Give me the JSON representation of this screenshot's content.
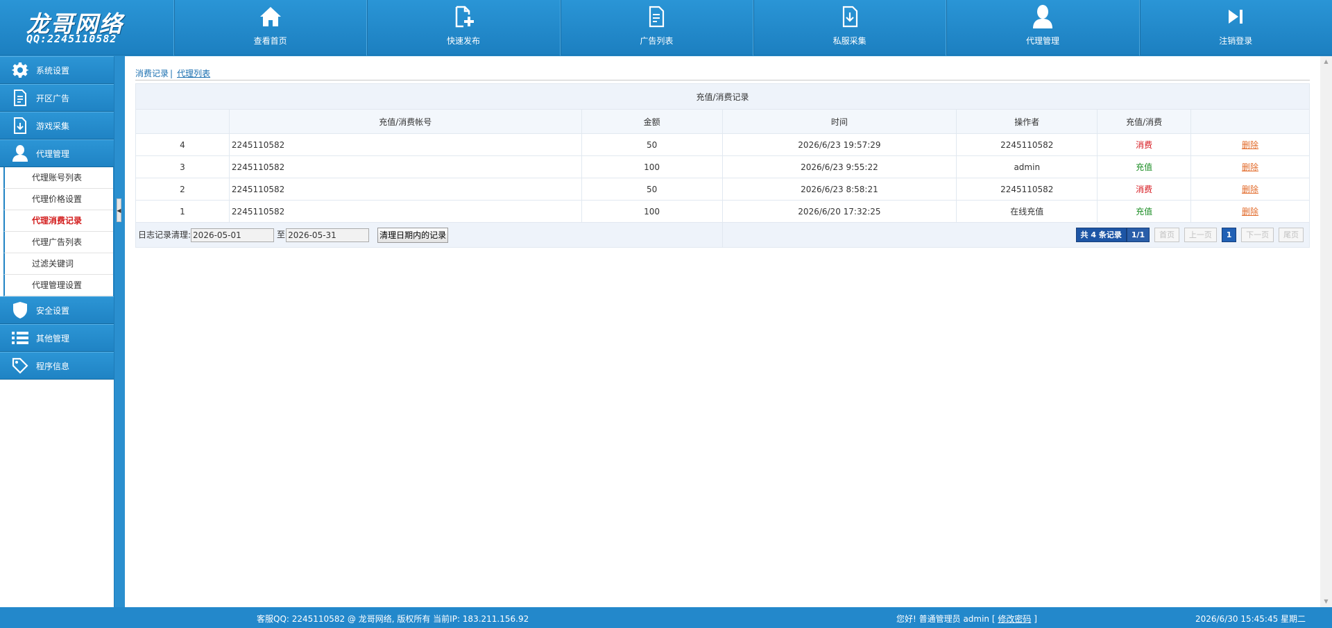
{
  "logo": {
    "brand": "龙哥网络",
    "qq": "QQ:2245110582"
  },
  "nav": [
    {
      "label": "查看首页",
      "icon": "home-icon"
    },
    {
      "label": "快速发布",
      "icon": "file-add-icon"
    },
    {
      "label": "广告列表",
      "icon": "document-list-icon"
    },
    {
      "label": "私服采集",
      "icon": "download-file-icon"
    },
    {
      "label": "代理管理",
      "icon": "user-icon"
    },
    {
      "label": "注销登录",
      "icon": "logout-icon"
    }
  ],
  "sidebar": {
    "top_groups": [
      {
        "label": "系统设置",
        "icon": "gear-icon"
      },
      {
        "label": "开区广告",
        "icon": "document-icon"
      },
      {
        "label": "游戏采集",
        "icon": "download-icon"
      },
      {
        "label": "代理管理",
        "icon": "user-icon"
      }
    ],
    "sub_items": [
      "代理账号列表",
      "代理价格设置",
      "代理消费记录",
      "代理广告列表",
      "过滤关键词",
      "代理管理设置"
    ],
    "active_sub": "代理消费记录",
    "bottom_groups": [
      {
        "label": "安全设置",
        "icon": "shield-icon"
      },
      {
        "label": "其他管理",
        "icon": "list-icon"
      },
      {
        "label": "程序信息",
        "icon": "tag-icon"
      }
    ]
  },
  "tabs": {
    "current": "消费记录",
    "separator": "|",
    "other": "代理列表"
  },
  "table": {
    "caption": "充值/消费记录",
    "headers": [
      "",
      "充值/消费帐号",
      "金额",
      "时间",
      "操作者",
      "充值/消费",
      ""
    ],
    "rows": [
      {
        "id": "4",
        "account": "2245110582",
        "amount": "50",
        "time": "2026/6/23 19:57:29",
        "operator": "2245110582",
        "type": "消费",
        "action": "删除"
      },
      {
        "id": "3",
        "account": "2245110582",
        "amount": "100",
        "time": "2026/6/23 9:55:22",
        "operator": "admin",
        "type": "充值",
        "action": "删除"
      },
      {
        "id": "2",
        "account": "2245110582",
        "amount": "50",
        "time": "2026/6/23 8:58:21",
        "operator": "2245110582",
        "type": "消费",
        "action": "删除"
      },
      {
        "id": "1",
        "account": "2245110582",
        "amount": "100",
        "time": "2026/6/20 17:32:25",
        "operator": "在线充值",
        "type": "充值",
        "action": "删除"
      }
    ],
    "footer": {
      "clear_label": "日志记录清理:",
      "start_date": "2026-05-01",
      "to_label": "至",
      "end_date": "2026-05-31",
      "clear_button": "清理日期内的记录"
    },
    "pager": {
      "total": "共 4 条记录",
      "fraction": "1/1",
      "first": "首页",
      "prev": "上一页",
      "current": "1",
      "next": "下一页",
      "last": "尾页"
    }
  },
  "colors": {
    "header_blue": "#2a95d6",
    "consume_red": "#d6161d",
    "recharge_green": "#1a8c23",
    "delete_orange": "#e26b2b"
  },
  "footer": {
    "support": "客服QQ:  2245110582   @ 龙哥网络, 版权所有  当前IP: 183.211.156.92",
    "greeting": "您好!  普通管理员 admin [",
    "change_pwd": "修改密码",
    "bracket_close": "]",
    "datetime": "2026/6/30 15:45:45 星期二"
  }
}
